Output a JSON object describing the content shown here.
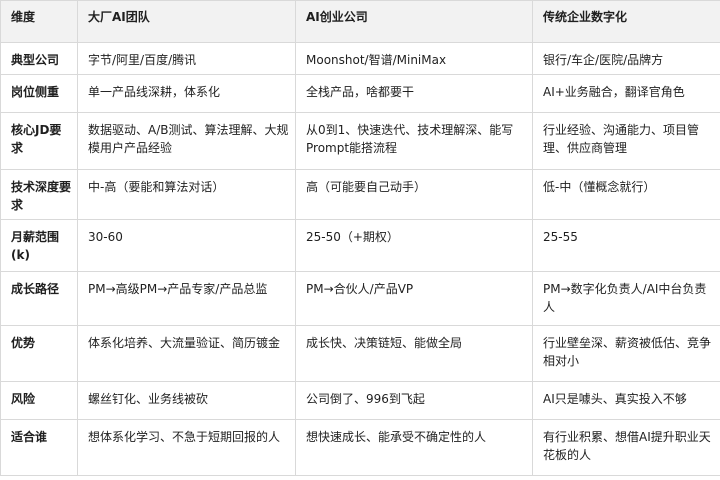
{
  "table": {
    "headers": [
      "维度",
      "大厂AI团队",
      "AI创业公司",
      "传统企业数字化"
    ],
    "rows": [
      {
        "label": "典型公司",
        "cells": [
          "字节/阿里/百度/腾讯",
          "Moonshot/智谱/MiniMax",
          "银行/车企/医院/品牌方"
        ]
      },
      {
        "label": "岗位侧重",
        "cells": [
          "单一产品线深耕，体系化",
          "全栈产品，啥都要干",
          "AI+业务融合，翻译官角色"
        ]
      },
      {
        "label": "核心JD要求",
        "cells": [
          "数据驱动、A/B测试、算法理解、大规模用户产品经验",
          "从0到1、快速迭代、技术理解深、能写Prompt能搭流程",
          "行业经验、沟通能力、项目管理、供应商管理"
        ]
      },
      {
        "label": "技术深度要求",
        "cells": [
          "中-高（要能和算法对话）",
          "高（可能要自己动手）",
          "低-中（懂概念就行）"
        ]
      },
      {
        "label": "月薪范围(k)",
        "cells": [
          "30-60",
          "25-50（+期权）",
          "25-55"
        ]
      },
      {
        "label": "成长路径",
        "cells": [
          "PM→高级PM→产品专家/产品总监",
          "PM→合伙人/产品VP",
          "PM→数字化负责人/AI中台负责人"
        ]
      },
      {
        "label": "优势",
        "cells": [
          "体系化培养、大流量验证、简历镀金",
          "成长快、决策链短、能做全局",
          "行业壁垒深、薪资被低估、竞争相对小"
        ]
      },
      {
        "label": "风险",
        "cells": [
          "螺丝钉化、业务线被砍",
          "公司倒了、996到飞起",
          "AI只是噱头、真实投入不够"
        ]
      },
      {
        "label": "适合谁",
        "cells": [
          "想体系化学习、不急于短期回报的人",
          "想快速成长、能承受不确定性的人",
          "有行业积累、想借AI提升职业天花板的人"
        ]
      }
    ]
  }
}
